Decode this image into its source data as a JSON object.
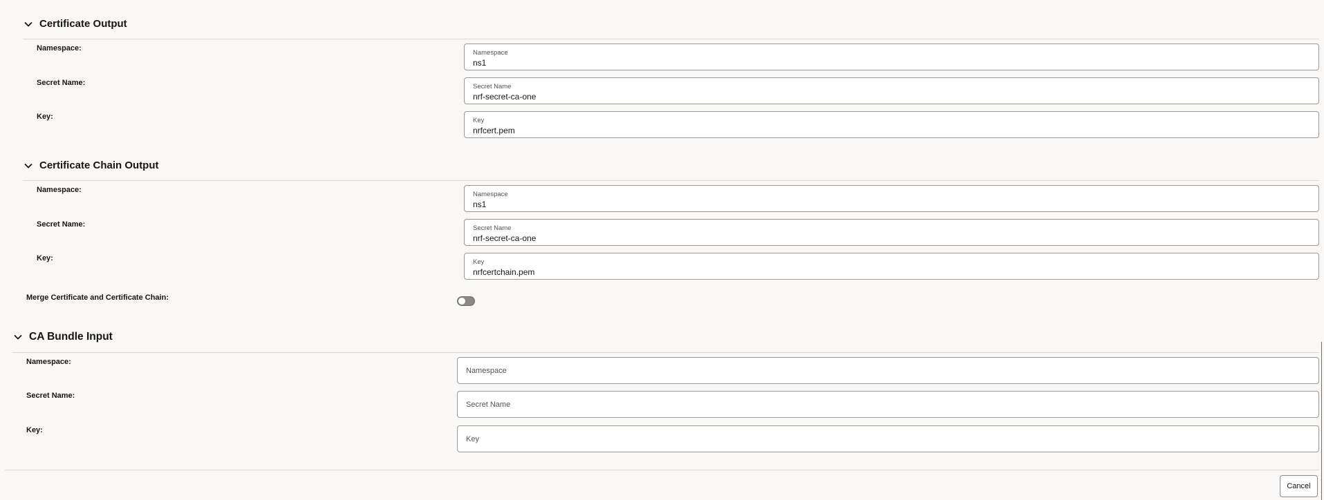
{
  "certificate_output": {
    "title": "Certificate Output",
    "namespace_label": "Namespace:",
    "namespace_field_label": "Namespace",
    "namespace_value": "ns1",
    "secret_label": "Secret Name:",
    "secret_field_label": "Secret Name",
    "secret_value": "nrf-secret-ca-one",
    "key_label": "Key:",
    "key_field_label": "Key",
    "key_value": "nrfcert.pem"
  },
  "certificate_chain_output": {
    "title": "Certificate Chain Output",
    "namespace_label": "Namespace:",
    "namespace_field_label": "Namespace",
    "namespace_value": "ns1",
    "secret_label": "Secret Name:",
    "secret_field_label": "Secret Name",
    "secret_value": "nrf-secret-ca-one",
    "key_label": "Key:",
    "key_field_label": "Key",
    "key_value": "nrfcertchain.pem"
  },
  "merge": {
    "label": "Merge Certificate and Certificate Chain:",
    "enabled": false
  },
  "ca_bundle_input": {
    "title": "CA Bundle Input",
    "namespace_label": "Namespace:",
    "namespace_placeholder": "Namespace",
    "secret_label": "Secret Name:",
    "secret_placeholder": "Secret Name",
    "key_label": "Key:",
    "key_placeholder": "Key"
  },
  "footer": {
    "cancel_label": "Cancel"
  },
  "icons": {
    "section_toggle": "chevron-down-icon"
  }
}
